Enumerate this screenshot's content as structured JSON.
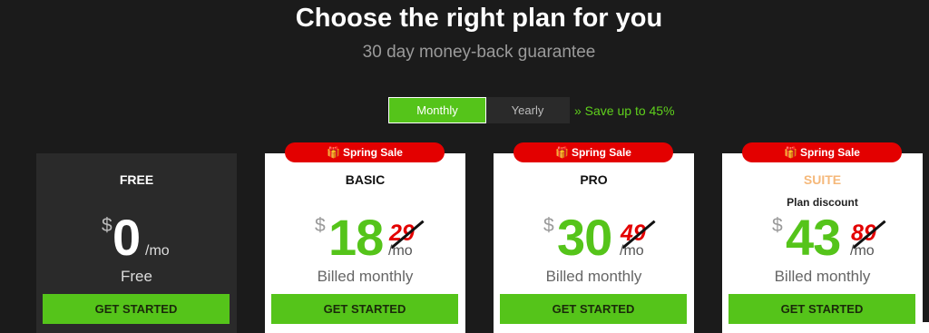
{
  "header": {
    "title": "Choose the right plan for you",
    "subtitle": "30 day money-back guarantee"
  },
  "billing_toggle": {
    "monthly_label": "Monthly",
    "yearly_label": "Yearly",
    "selected": "Monthly",
    "save_note": "» Save up to 45%"
  },
  "plans": [
    {
      "name": "FREE",
      "currency": "$",
      "price": "0",
      "per": "/mo",
      "billing": "Free",
      "cta": "GET STARTED"
    },
    {
      "badge": "Spring Sale",
      "name": "BASIC",
      "currency": "$",
      "price": "18",
      "old_price": "29",
      "per": "/mo",
      "billing": "Billed monthly",
      "cta": "GET STARTED"
    },
    {
      "badge": "Spring Sale",
      "name": "PRO",
      "currency": "$",
      "price": "30",
      "old_price": "49",
      "per": "/mo",
      "billing": "Billed monthly",
      "cta": "GET STARTED"
    },
    {
      "badge": "Spring Sale",
      "name": "SUITE",
      "discount_note": "Plan discount",
      "currency": "$",
      "price": "43",
      "old_price": "89",
      "per": "/mo",
      "billing": "Billed monthly",
      "cta": "GET STARTED"
    }
  ],
  "colors": {
    "background": "#1b1b1b",
    "accent_green": "#55c41a",
    "sale_red": "#e30000",
    "suite_name": "#f5b87a"
  },
  "icons": {
    "badge_icon": "gift-icon"
  }
}
